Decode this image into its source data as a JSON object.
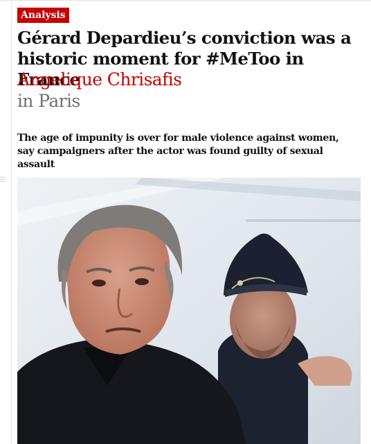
{
  "article": {
    "tag": "Analysis",
    "headline": "Gérard Depardieu’s conviction was a historic moment for #MeToo in France",
    "author": "Angelique Chrisafis",
    "location": "in Paris",
    "standfirst": "The age of impunity is over for male violence against women, say campaigners after the actor was found guilty of sexual assault"
  },
  "colors": {
    "accent": "#c70000",
    "text": "#121212",
    "muted": "#707070"
  },
  "icons": {
    "photo_subject": "depardieu-with-police-officer-photo"
  }
}
